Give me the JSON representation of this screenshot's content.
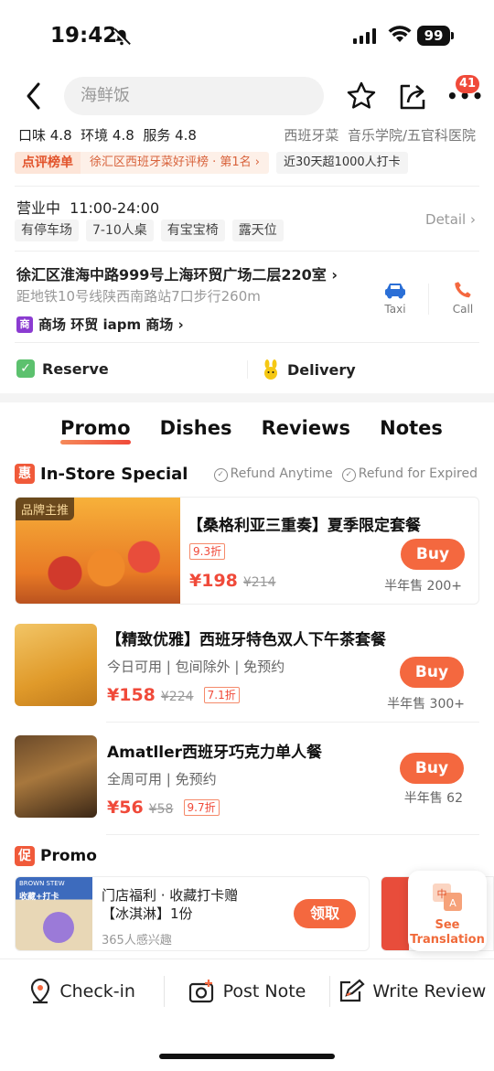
{
  "status_bar": {
    "time": "19:42",
    "battery": "99"
  },
  "header": {
    "search_placeholder": "海鲜饭",
    "notification_count": "41"
  },
  "ratings": {
    "text": "口味 4.8  环境 4.8  服务 4.8",
    "cuisine": "西班牙菜  音乐学院/五官科医院"
  },
  "ranking": {
    "label": "点评榜单",
    "detail": "徐汇区西班牙菜好评榜 · 第1名 ›",
    "checkins": "近30天超1000人打卡"
  },
  "hours": {
    "text": "营业中  11:00-24:00",
    "tags": [
      "有停车场",
      "7-10人桌",
      "有宝宝椅",
      "露天位"
    ],
    "detail_label": "Detail ›"
  },
  "location": {
    "address": "徐汇区淮海中路999号上海环贸广场二层220室 ›",
    "subway": "距地铁10号线陕西南路站7口步行260m",
    "mall": "商场 环贸 iapm 商场 ›",
    "mall_icon": "商",
    "taxi_label": "Taxi",
    "call_label": "Call"
  },
  "services": {
    "reserve": "Reserve",
    "delivery": "Delivery"
  },
  "tabs": [
    "Promo",
    "Dishes",
    "Reviews",
    "Notes"
  ],
  "instore": {
    "icon": "惠",
    "title": "In-Store Special",
    "refund1": "Refund Anytime",
    "refund2": "Refund for Expired"
  },
  "deals": [
    {
      "badge": "品牌主推",
      "title": "【桑格利亚三重奏】夏季限定套餐",
      "discount": "9.3折",
      "price": "¥198",
      "old_price": "¥214",
      "sold": "半年售 200+",
      "buy": "Buy"
    },
    {
      "title": "【精致优雅】西班牙特色双人下午茶套餐",
      "sub": "今日可用 | 包间除外 | 免预约",
      "price": "¥158",
      "old_price": "¥224",
      "discount": "7.1折",
      "sold": "半年售 300+",
      "buy": "Buy"
    },
    {
      "title": "Amatller西班牙巧克力单人餐",
      "sub": "全周可用 | 免预约",
      "price": "¥56",
      "old_price": "¥58",
      "discount": "9.7折",
      "sold": "半年售 62",
      "buy": "Buy"
    }
  ],
  "promo": {
    "icon": "促",
    "title": "Promo",
    "coupon_title": "门店福利 · 收藏打卡赠\n【冰淇淋】1份",
    "coupon_interest": "365人感兴趣",
    "claim": "领取",
    "coupon_img_text": "收藏+打卡",
    "coupon_img_brand": "BROWN STEW",
    "see_translation": "See\nTranslation"
  },
  "bottom": {
    "checkin": "Check-in",
    "post_note": "Post Note",
    "write_review": "Write Review"
  },
  "colors": {
    "accent": "#f4683f",
    "price": "#f04a3a",
    "reserve_green": "#5cc16e",
    "mall_purple": "#8b3bd1"
  }
}
